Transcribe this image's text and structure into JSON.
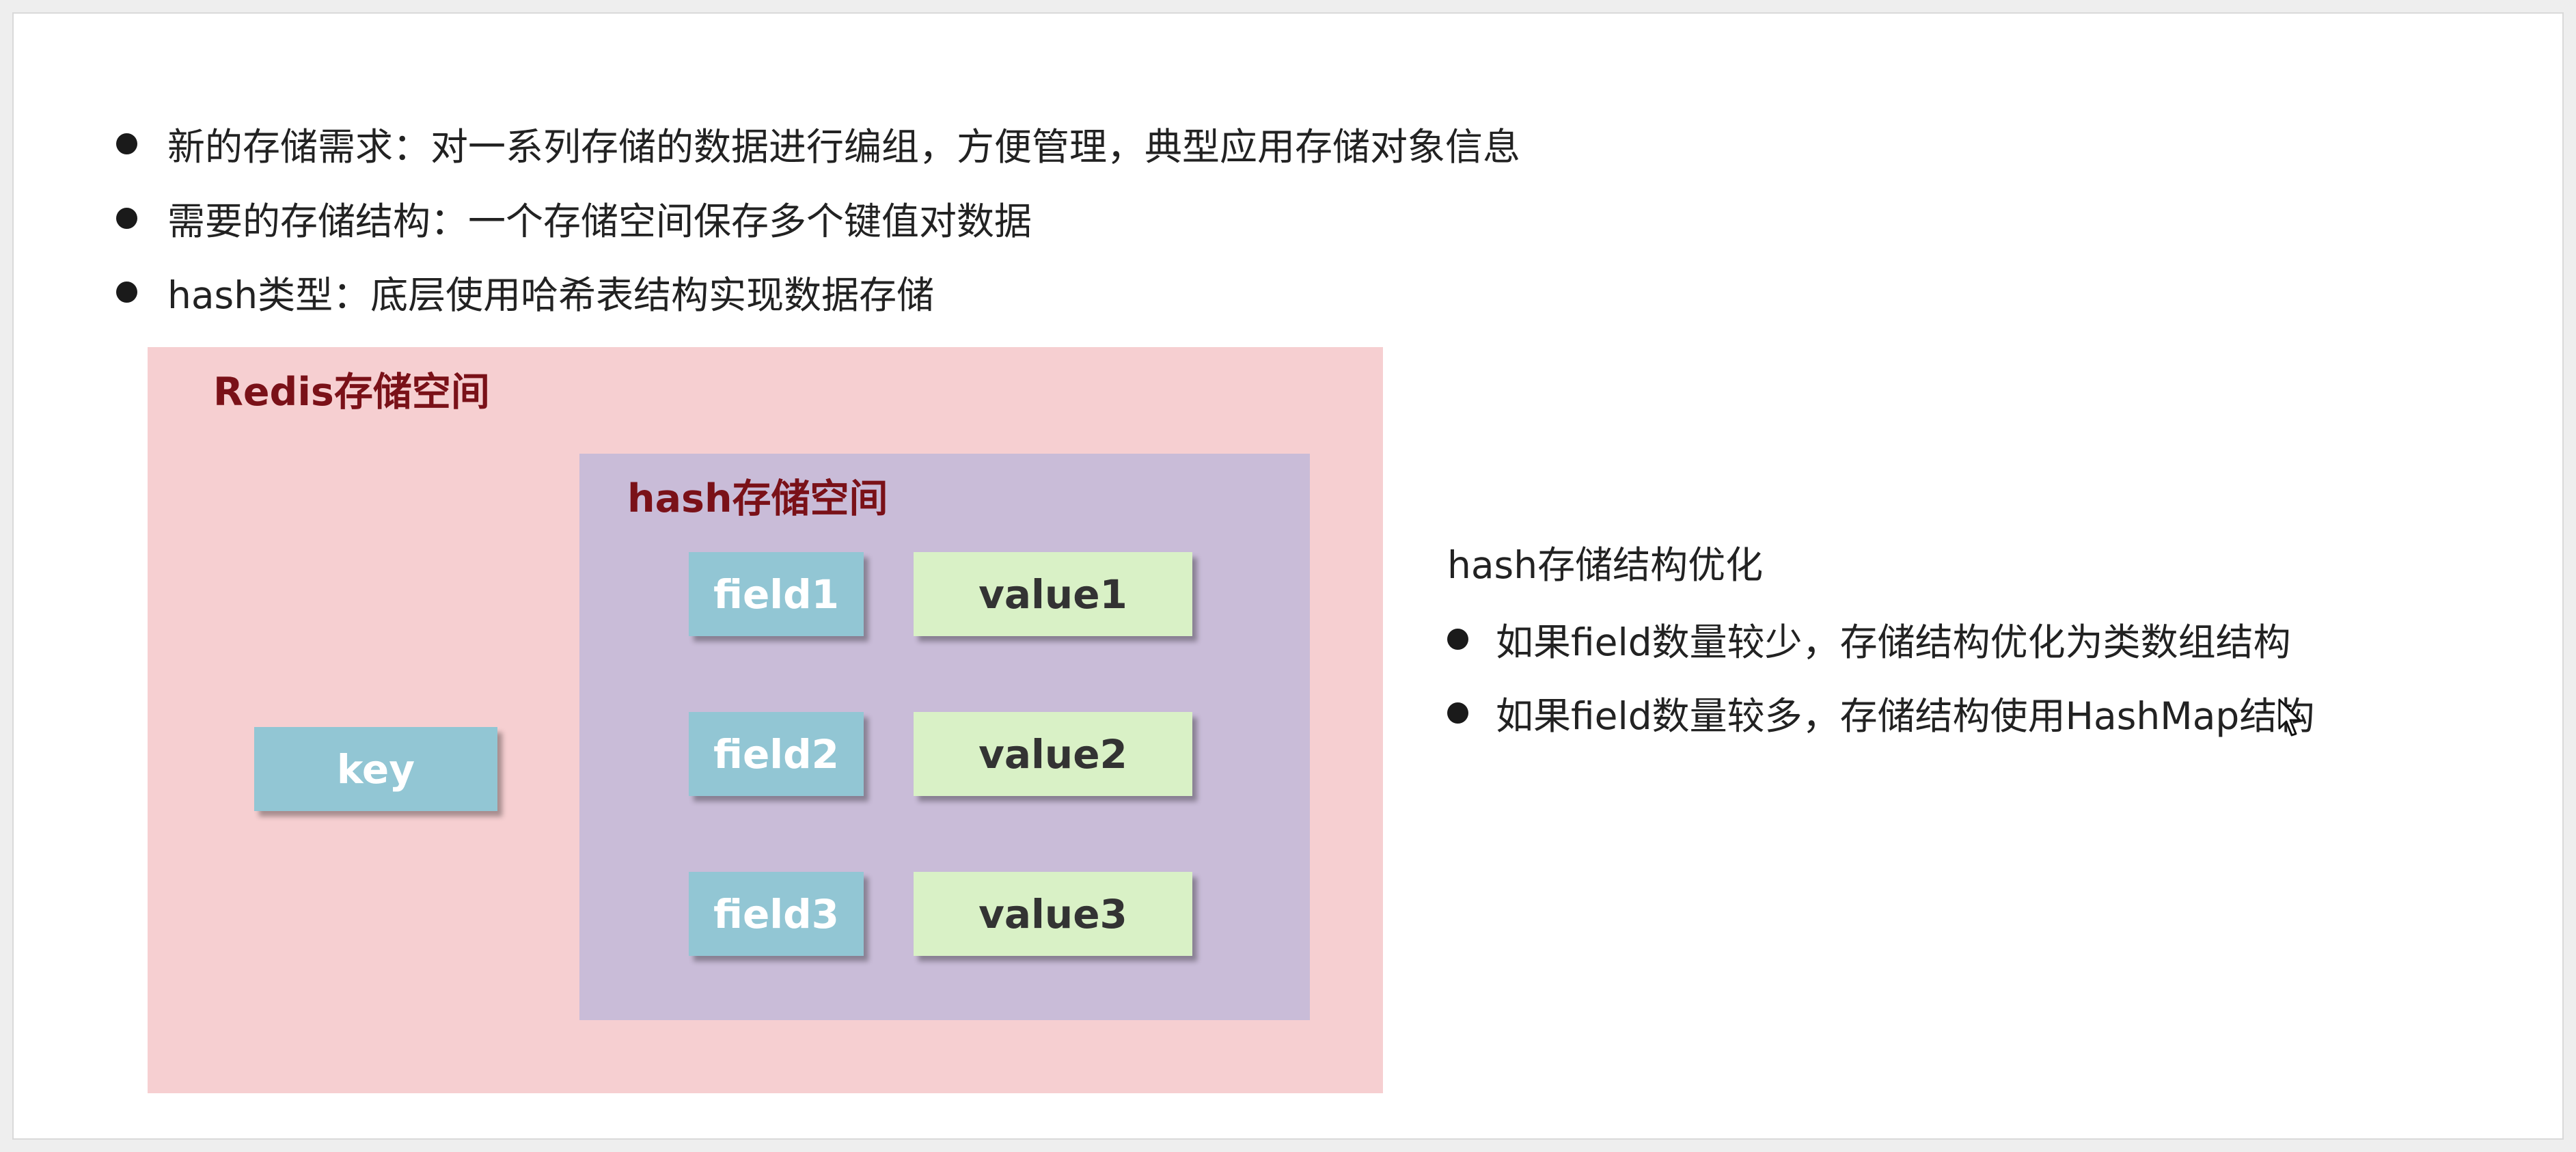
{
  "bullets": [
    "新的存储需求：对一系列存储的数据进行编组，方便管理，典型应用存储对象信息",
    "需要的存储结构：一个存储空间保存多个键值对数据",
    "hash类型：底层使用哈希表结构实现数据存储"
  ],
  "diagram": {
    "outer_title": "Redis存储空间",
    "key_label": "key",
    "inner_title": "hash存储空间",
    "fields": [
      "field1",
      "field2",
      "field3"
    ],
    "values": [
      "value1",
      "value2",
      "value3"
    ]
  },
  "optimization": {
    "title": "hash存储结构优化",
    "items": [
      "如果field数量较少，存储结构优化为类数组结构",
      "如果field数量较多，存储结构使用HashMap结构"
    ]
  },
  "colors": {
    "outer_bg": "#f6cfd1",
    "inner_bg": "#c9bcd8",
    "title_color": "#7a1118",
    "key_field_bg": "#92c6d4",
    "value_bg": "#d9f1c6"
  }
}
